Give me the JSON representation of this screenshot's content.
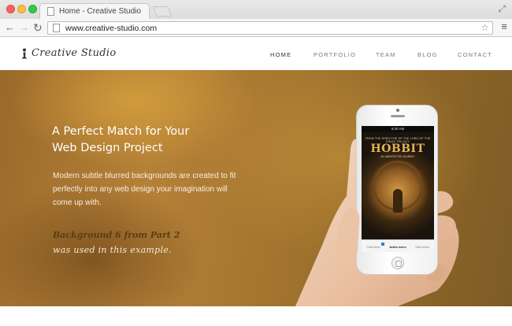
{
  "browser": {
    "tab_title": "Home - Creative Studio",
    "url": "www.creative-studio.com"
  },
  "site": {
    "logo_text": "Creative Studio",
    "nav": [
      "HOME",
      "PORTFOLIO",
      "TEAM",
      "BLOG",
      "CONTACT"
    ],
    "active_nav": "HOME"
  },
  "hero": {
    "title_line1": "A Perfect Match for Your",
    "title_line2": "Web Design Project",
    "text": "Modern subtle blurred backgrounds are created to fit perfectly into any web design your imagination will come up with.",
    "note_line1": "Background 6 from Part 2",
    "note_line2": "was used in this example."
  },
  "phone": {
    "status_time": "9:30 AM",
    "poster_caption": "FROM THE DIRECTOR OF THE LORD OF THE RINGS TRILOGY",
    "poster_title": "HOBBIT",
    "poster_sub": "AN UNEXPECTED JOURNEY",
    "tabs": [
      "First menu",
      "Active menu",
      "Third menu"
    ]
  },
  "colors": {
    "accent": "#b58138",
    "note_dark": "#5a3d16"
  },
  "icons": {
    "back": "arrow-left",
    "forward": "arrow-right",
    "reload": "reload",
    "star": "star",
    "menu": "hamburger",
    "expand": "expand"
  }
}
